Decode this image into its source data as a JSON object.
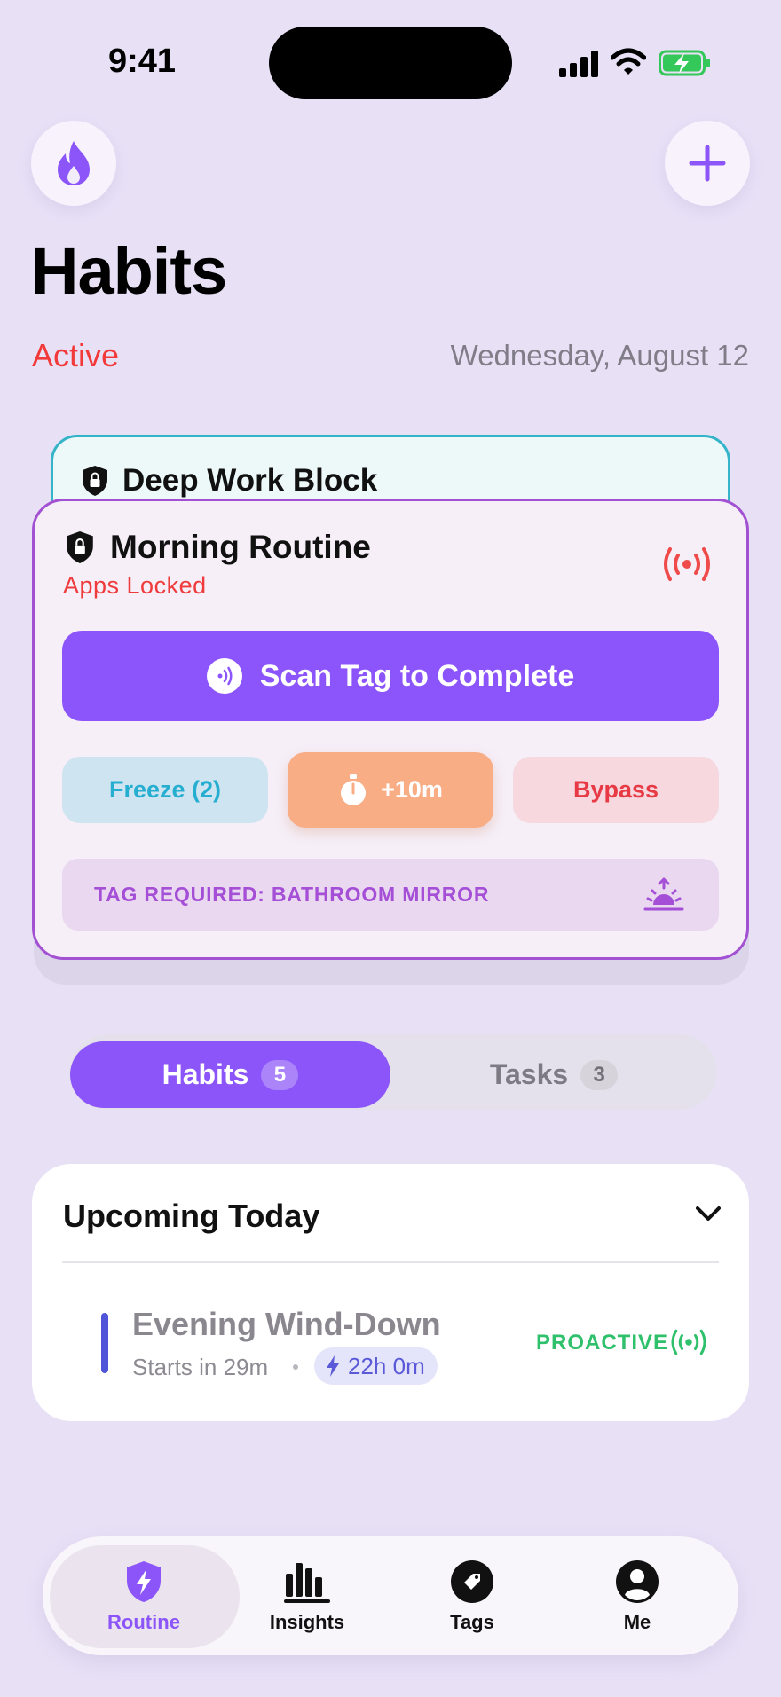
{
  "status_bar": {
    "time": "9:41"
  },
  "header": {
    "title": "Habits",
    "status": "Active",
    "date": "Wednesday, August 12"
  },
  "stack_back_card": {
    "title": "Deep Work Block"
  },
  "active_card": {
    "title": "Morning Routine",
    "subtitle": "Apps Locked",
    "scan_button": "Scan Tag to Complete",
    "freeze_button": "Freeze (2)",
    "extend_button": "+10m",
    "bypass_button": "Bypass",
    "tag_requirement": "TAG REQUIRED: BATHROOM MIRROR"
  },
  "segmented_control": {
    "habits_label": "Habits",
    "habits_count": "5",
    "tasks_label": "Tasks",
    "tasks_count": "3"
  },
  "upcoming": {
    "title": "Upcoming Today",
    "items": [
      {
        "title": "Evening Wind-Down",
        "starts": "Starts in 29m",
        "duration": "22h 0m",
        "mode": "PROACTIVE"
      }
    ]
  },
  "tab_bar": {
    "tabs": [
      {
        "label": "Routine"
      },
      {
        "label": "Insights"
      },
      {
        "label": "Tags"
      },
      {
        "label": "Me"
      }
    ]
  },
  "colors": {
    "background": "#e8e1f6",
    "accent": "#8b55f9",
    "danger": "#ef3b3b",
    "freeze": "#25aed0",
    "extend": "#f8ad85",
    "proactive": "#2fc06b"
  }
}
